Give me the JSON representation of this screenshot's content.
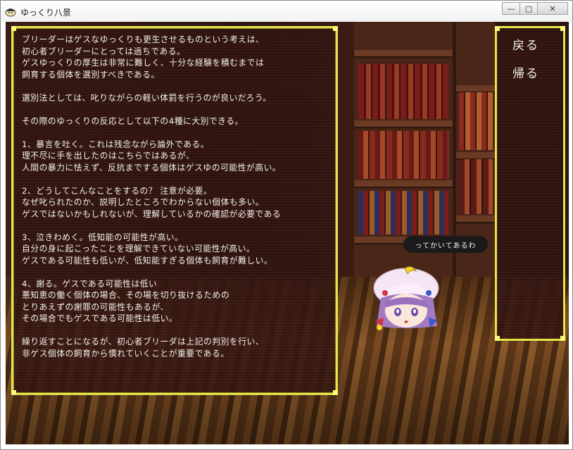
{
  "window": {
    "title": "ゆっくり八景",
    "minimize_glyph": "—",
    "maximize_glyph": "□",
    "close_glyph": "✕"
  },
  "dialog": {
    "lines": [
      "ブリーダーはゲスなゆっくりも更生させるものという考えは、",
      "初心者ブリーダーにとっては過ちである。",
      "ゲスゆっくりの厚生は非常に難しく、十分な経験を積むまでは",
      "飼育する個体を選別すべきである。",
      "",
      "選別法としては、叱りながらの軽い体罰を行うのが良いだろう。",
      "",
      "その際のゆっくりの反応として以下の4種に大別できる。",
      "",
      "1、暴言を吐く。これは残念ながら論外である。",
      "理不尽に手を出したのはこちらではあるが、",
      "人間の暴力に怯えず、反抗までする個体はゲスゆの可能性が高い。",
      "",
      "2、どうしてこんなことをするの？ 注意が必要。",
      "なぜ叱られたのか、説明したところでわからない個体も多い。",
      "ゲスではないかもしれないが、理解しているかの確認が必要である",
      "",
      "3、泣きわめく。低知能の可能性が高い。",
      "自分の身に起こったことを理解できていない可能性が高い。",
      "ゲスである可能性も低いが、低知能すぎる個体も飼育が難しい。",
      "",
      "4、謝る。ゲスである可能性は低い",
      "悪知恵の働く個体の場合、その場を切り抜けるための",
      "とりあえずの謝罪の可能性もあるが、",
      "その場合でもゲスである可能性は低い。",
      "",
      "繰り返すことになるが、初心者ブリーダは上記の判別を行い、",
      "非ゲス個体の飼育から慣れていくことが重要である。"
    ]
  },
  "menu": {
    "back_label": "戻る",
    "return_label": "帰る"
  },
  "speech_bubble": {
    "text": "ってかいてあるわ"
  },
  "colors": {
    "panel_border": "#e6e64a",
    "text": "#f4f1ea"
  }
}
